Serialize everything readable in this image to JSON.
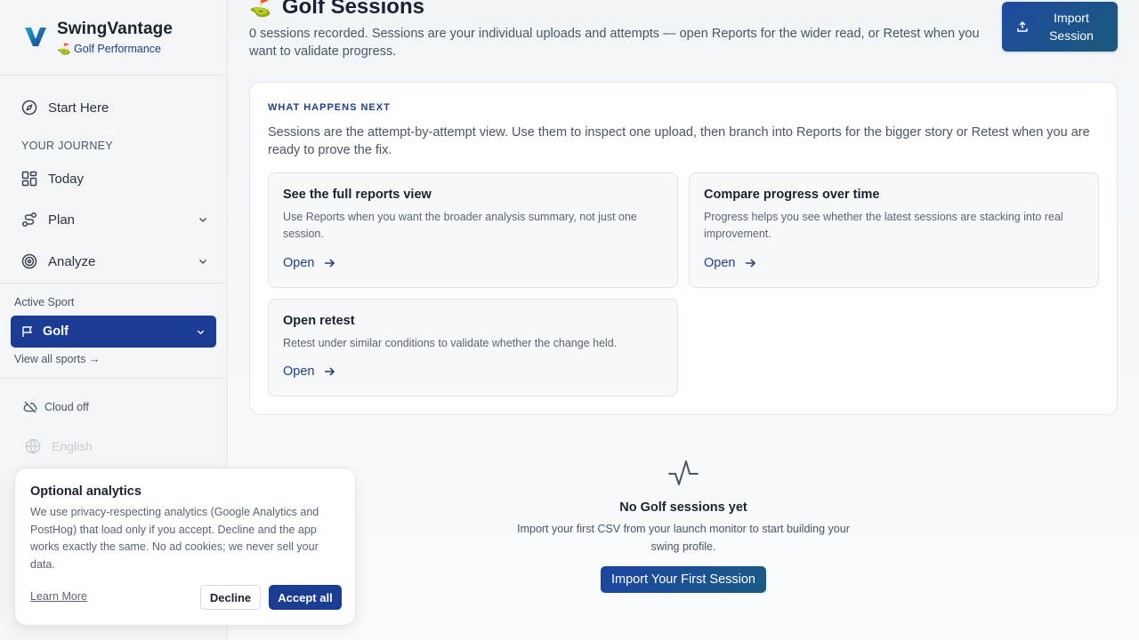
{
  "brand": {
    "name": "SwingVantage",
    "subtitle": "⛳ Golf Performance",
    "logo_icon": "v-logo-icon"
  },
  "sidebar": {
    "start_here": "Start Here",
    "journey_label": "YOUR JOURNEY",
    "items": [
      {
        "label": "Today",
        "icon": "grid-icon"
      },
      {
        "label": "Plan",
        "icon": "route-icon"
      },
      {
        "label": "Analyze",
        "icon": "target-icon"
      }
    ],
    "active_sport_label": "Active Sport",
    "active_sport": "Golf",
    "view_all": "View all sports →",
    "cloud_status": "Cloud off",
    "language": "English"
  },
  "header": {
    "flag": "⛳",
    "title": "Golf Sessions",
    "description": "0 sessions recorded. Sessions are your individual uploads and attempts — open Reports for the wider read, or Retest when you want to validate progress.",
    "import_label_1": "Import",
    "import_label_2": "Session"
  },
  "next": {
    "eyebrow": "WHAT HAPPENS NEXT",
    "description": "Sessions are the attempt-by-attempt view. Use them to inspect one upload, then branch into Reports for the bigger story or Retest when you are ready to prove the fix.",
    "options": [
      {
        "title": "See the full reports view",
        "desc": "Use Reports when you want the broader analysis summary, not just one session.",
        "link": "Open"
      },
      {
        "title": "Compare progress over time",
        "desc": "Progress helps you see whether the latest sessions are stacking into real improvement.",
        "link": "Open"
      },
      {
        "title": "Open retest",
        "desc": "Retest under similar conditions to validate whether the change held.",
        "link": "Open"
      }
    ]
  },
  "empty": {
    "title": "No Golf sessions yet",
    "desc": "Import your first CSV from your launch monitor to start building your swing profile.",
    "button": "Import Your First Session"
  },
  "cookie": {
    "title": "Optional analytics",
    "desc": "We use privacy-respecting analytics (Google Analytics and PostHog) that load only if you accept. Decline and the app works exactly the same. No ad cookies; we never sell your data.",
    "learn_more": "Learn More",
    "decline": "Decline",
    "accept": "Accept all"
  },
  "colors": {
    "primary": "#1b3c93",
    "accent_link": "#1e3f8a",
    "teal": "#1a5c82"
  }
}
